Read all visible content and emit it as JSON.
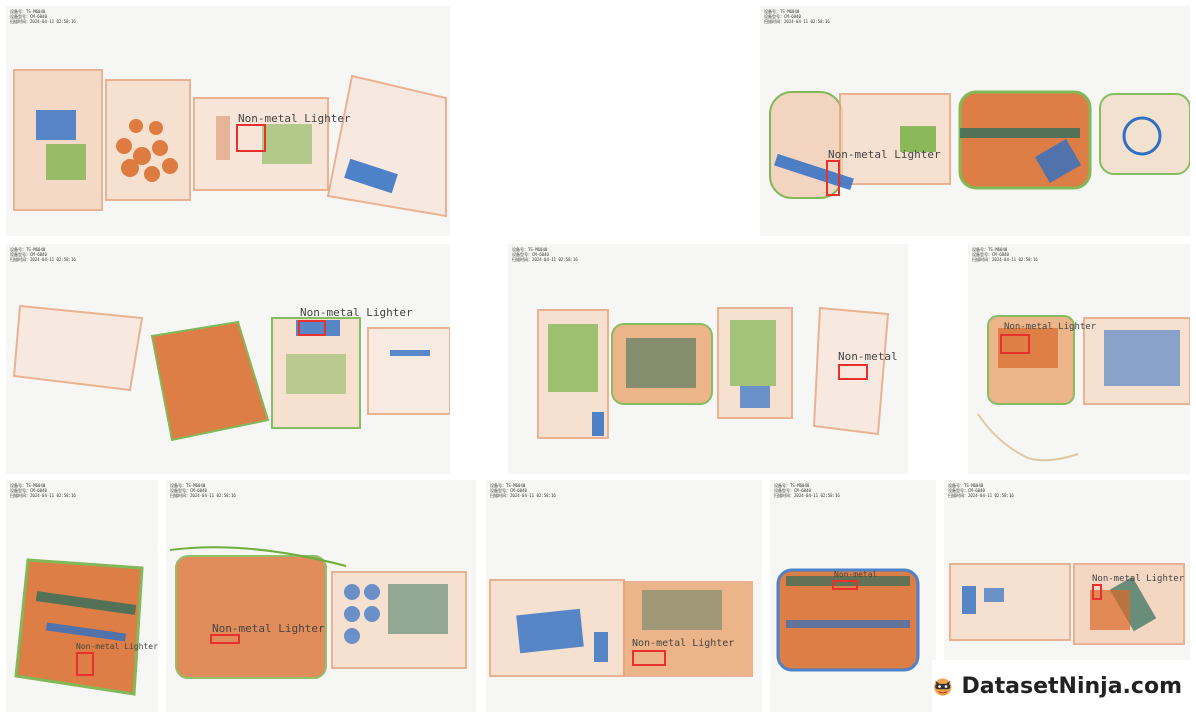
{
  "label": "Non-metal Lighter",
  "label_short": "Non-metal",
  "meta_lines": [
    "设备号：TS-M6040",
    "设备型号：CM-6040",
    "扫描时间：2024-04-11 02:58:16"
  ],
  "brand": {
    "name": "DatasetNinja.com"
  },
  "colors": {
    "organic": "#e0793a",
    "metal": "#2f6fc4",
    "mixed": "#6fae3d",
    "box": "#e8302c"
  }
}
